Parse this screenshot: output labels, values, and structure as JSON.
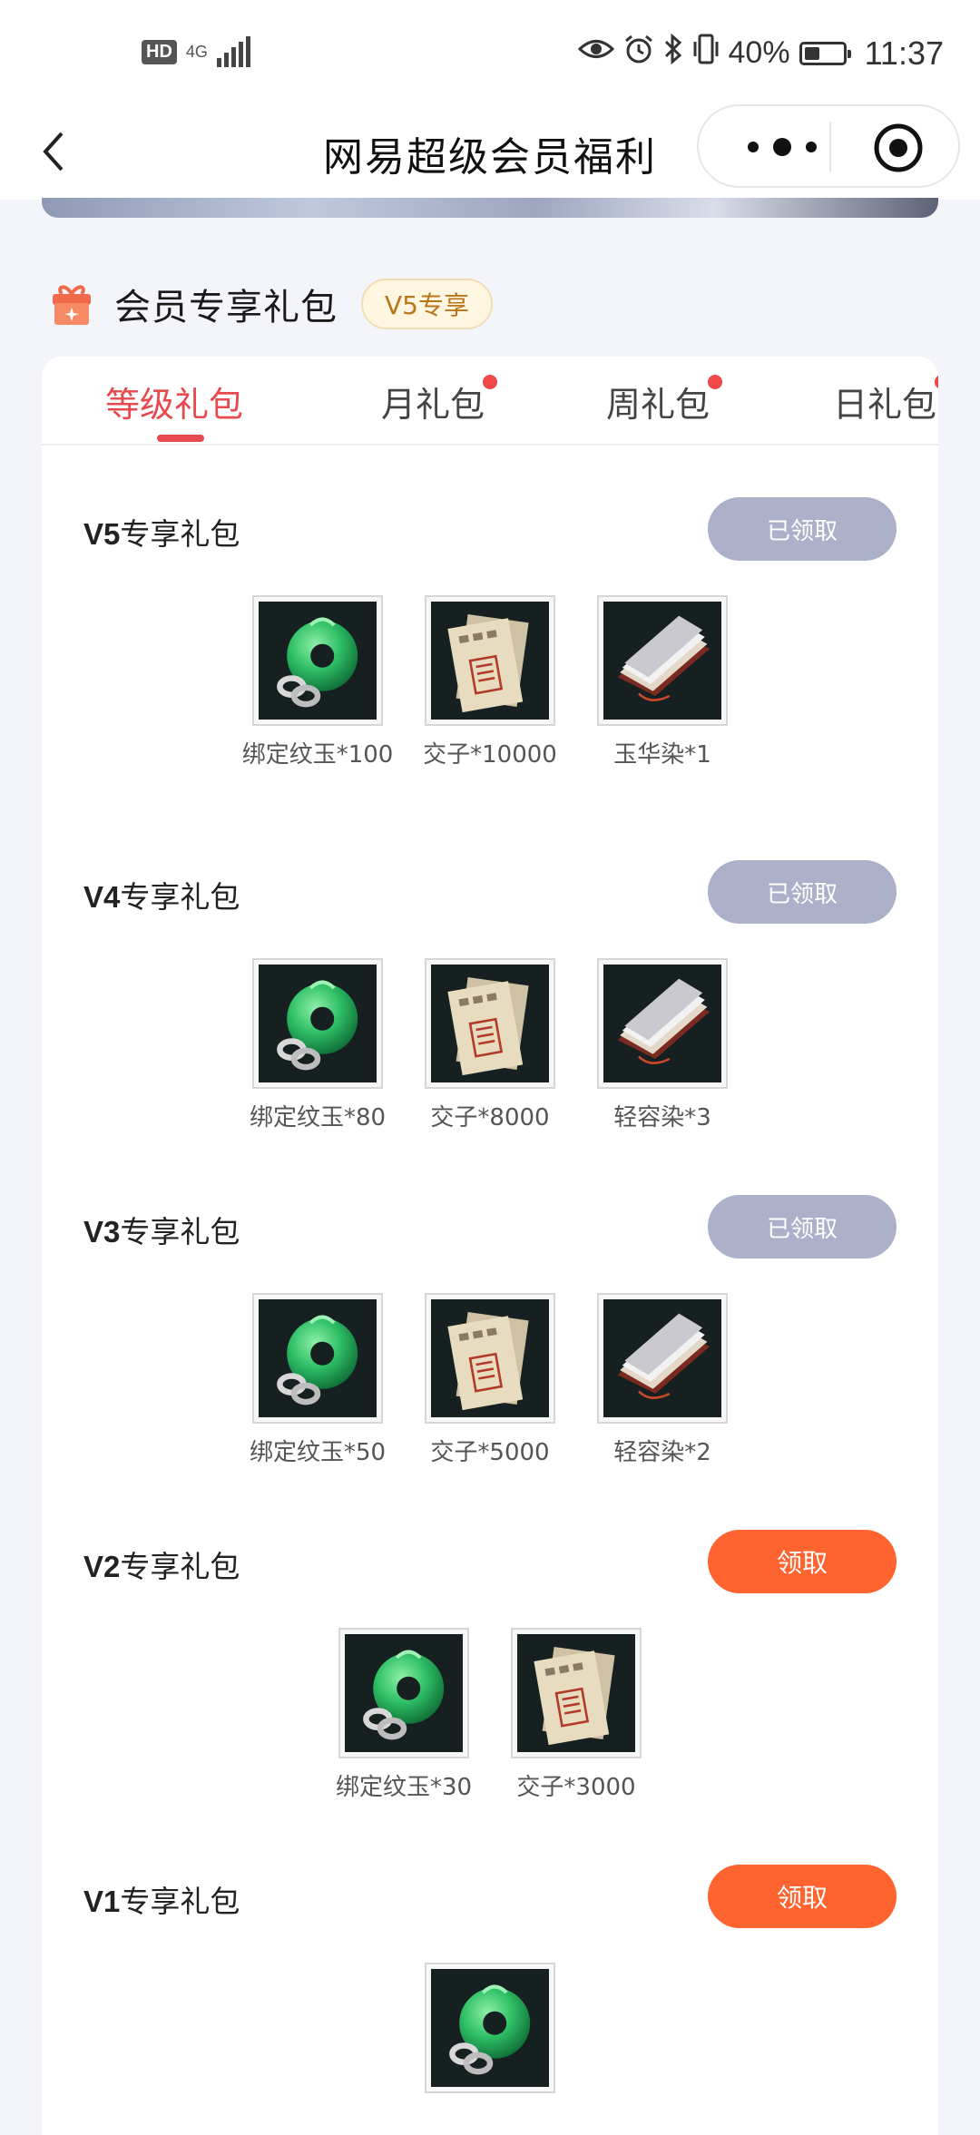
{
  "status_bar": {
    "hd": "HD",
    "network": "4G",
    "battery": "40%",
    "battery_level": 0.4,
    "time": "11:37"
  },
  "nav": {
    "title": "网易超级会员福利"
  },
  "section": {
    "title": "会员专享礼包",
    "badge": "V5专享"
  },
  "tabs": [
    {
      "label": "等级礼包",
      "active": true,
      "dot": false
    },
    {
      "label": "月礼包",
      "active": false,
      "dot": true
    },
    {
      "label": "周礼包",
      "active": false,
      "dot": true
    },
    {
      "label": "日礼包",
      "active": false,
      "dot": true
    }
  ],
  "gifts": [
    {
      "level": "V5",
      "title_suffix": "专享礼包",
      "button": "已领取",
      "claimed": true,
      "items": [
        {
          "icon": "jade-pendant-icon",
          "label": "绑定纹玉*100"
        },
        {
          "icon": "jiaozi-note-icon",
          "label": "交子*10000"
        },
        {
          "icon": "dye-scroll-icon",
          "label": "玉华染*1"
        }
      ]
    },
    {
      "level": "V4",
      "title_suffix": "专享礼包",
      "button": "已领取",
      "claimed": true,
      "items": [
        {
          "icon": "jade-pendant-icon",
          "label": "绑定纹玉*80"
        },
        {
          "icon": "jiaozi-note-icon",
          "label": "交子*8000"
        },
        {
          "icon": "dye-scroll-icon",
          "label": "轻容染*3"
        }
      ]
    },
    {
      "level": "V3",
      "title_suffix": "专享礼包",
      "button": "已领取",
      "claimed": true,
      "items": [
        {
          "icon": "jade-pendant-icon",
          "label": "绑定纹玉*50"
        },
        {
          "icon": "jiaozi-note-icon",
          "label": "交子*5000"
        },
        {
          "icon": "dye-scroll-icon",
          "label": "轻容染*2"
        }
      ]
    },
    {
      "level": "V2",
      "title_suffix": "专享礼包",
      "button": "领取",
      "claimed": false,
      "items": [
        {
          "icon": "jade-pendant-icon",
          "label": "绑定纹玉*30"
        },
        {
          "icon": "jiaozi-note-icon",
          "label": "交子*3000"
        }
      ]
    },
    {
      "level": "V1",
      "title_suffix": "专享礼包",
      "button": "领取",
      "claimed": false,
      "items": [
        {
          "icon": "jade-pendant-icon",
          "label": ""
        }
      ]
    }
  ]
}
